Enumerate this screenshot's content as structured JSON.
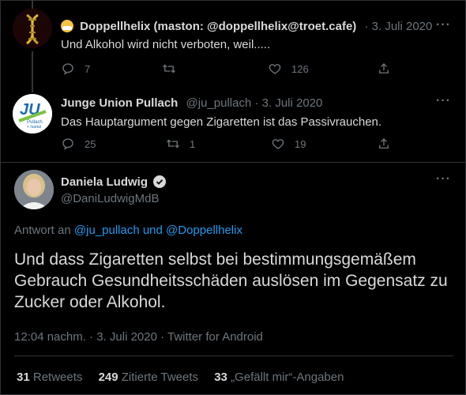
{
  "tweets": [
    {
      "display_name": "Doppellhelix (maston: @doppellhelix@troet.cafe)",
      "handle_date": "· 3. Juli 2020",
      "text": "Und Alkohol wird nicht verboten, weil.....",
      "replies": "7",
      "retweets": "",
      "likes": "126"
    },
    {
      "display_name": "Junge Union Pullach",
      "handle_date": "@ju_pullach · 3. Juli 2020",
      "text": "Das Hauptargument gegen Zigaretten ist das Passivrauchen.",
      "replies": "25",
      "retweets": "1",
      "likes": "19",
      "logo_text": [
        "JU",
        "Pullach",
        "+ Isartal"
      ]
    }
  ],
  "main": {
    "display_name": "Daniela Ludwig",
    "handle": "@DaniLudwigMdB",
    "reply_prefix": "Antwort an",
    "reply_targets": "@ju_pullach und @Doppellhelix",
    "text": "Und dass Zigaretten selbst bei bestimmungsgemäßem Gebrauch Gesundheitsschäden auslösen im Gegensatz zu Zucker oder Alkohol.",
    "meta": "12:04 nachm. · 3. Juli 2020 · Twitter for Android"
  },
  "stats": {
    "retweets_count": "31",
    "retweets_label": "Retweets",
    "quotes_count": "249",
    "quotes_label": "Zitierte Tweets",
    "likes_count": "33",
    "likes_label": "„Gefällt mir“-Angaben"
  },
  "icons": {
    "reply": "reply-icon",
    "retweet": "retweet-icon",
    "like": "heart-icon",
    "share": "share-icon",
    "more": "more-icon",
    "verified": "verified-badge-icon"
  },
  "colors": {
    "background": "#000000",
    "link": "#1d9bf0",
    "muted": "#6e767d"
  }
}
